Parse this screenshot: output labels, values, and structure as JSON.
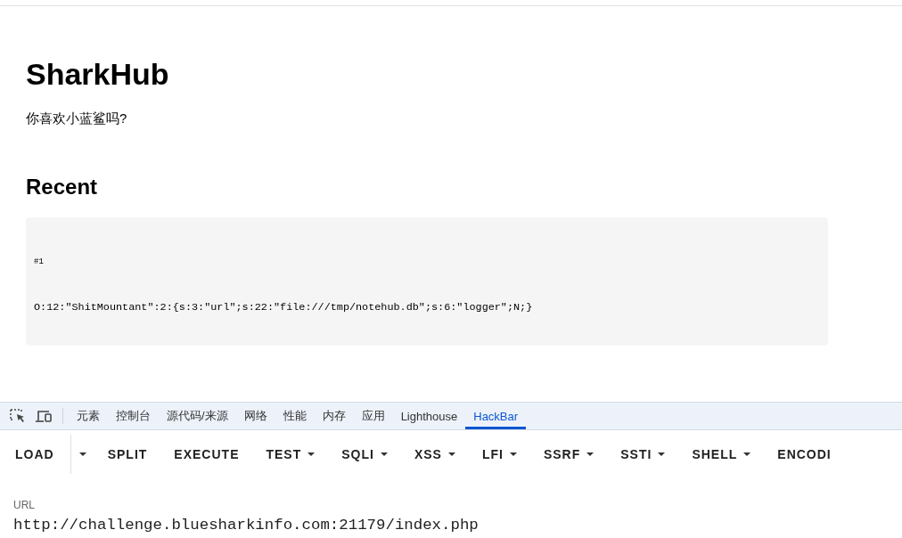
{
  "page": {
    "title": "SharkHub",
    "subtitle": "你喜欢小蓝鲨吗?",
    "section_heading": "Recent",
    "entries": [
      {
        "label": "#1",
        "content": "O:12:\"ShitMountant\":2:{s:3:\"url\";s:22:\"file:///tmp/notehub.db\";s:6:\"logger\";N;}"
      }
    ]
  },
  "devtools": {
    "tabs": [
      {
        "label": "元素",
        "selected": false
      },
      {
        "label": "控制台",
        "selected": false
      },
      {
        "label": "源代码/来源",
        "selected": false
      },
      {
        "label": "网络",
        "selected": false
      },
      {
        "label": "性能",
        "selected": false
      },
      {
        "label": "内存",
        "selected": false
      },
      {
        "label": "应用",
        "selected": false
      },
      {
        "label": "Lighthouse",
        "selected": false
      },
      {
        "label": "HackBar",
        "selected": true
      }
    ],
    "hackbar": {
      "buttons": [
        {
          "label": "LOAD",
          "kind": "button"
        },
        {
          "kind": "split-toggle"
        },
        {
          "label": "SPLIT",
          "kind": "button"
        },
        {
          "label": "EXECUTE",
          "kind": "button"
        },
        {
          "label": "TEST",
          "kind": "menu"
        },
        {
          "label": "SQLI",
          "kind": "menu"
        },
        {
          "label": "XSS",
          "kind": "menu"
        },
        {
          "label": "LFI",
          "kind": "menu"
        },
        {
          "label": "SSRF",
          "kind": "menu"
        },
        {
          "label": "SSTI",
          "kind": "menu"
        },
        {
          "label": "SHELL",
          "kind": "menu"
        },
        {
          "label": "ENCODI",
          "kind": "button"
        }
      ],
      "url_label": "URL",
      "url_value": "http://challenge.bluesharkinfo.com:21179/index.php"
    }
  }
}
